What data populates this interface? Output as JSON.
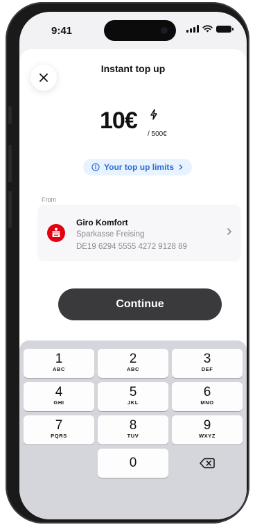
{
  "status_bar": {
    "time": "9:41",
    "signal_icon": "cellular-signal-icon",
    "wifi_icon": "wifi-icon",
    "battery_icon": "battery-icon"
  },
  "header": {
    "title": "Instant top up",
    "close_icon": "close-icon"
  },
  "amount": {
    "value": "10€",
    "limit": "/ 500€",
    "icon": "lightning-bolt-icon"
  },
  "limits_link": {
    "label": "Your top up limits",
    "info_icon": "info-icon",
    "chevron_icon": "chevron-right-icon"
  },
  "source": {
    "label": "From",
    "account_name": "Giro Komfort",
    "bank_name": "Sparkasse Freising",
    "iban": "DE19 6294 5555 4272 9128 89",
    "bank_logo_icon": "sparkasse-logo-icon",
    "chevron_icon": "chevron-right-icon"
  },
  "continue_button": {
    "label": "Continue"
  },
  "keypad": {
    "keys": [
      {
        "num": "1",
        "letters": "ABC"
      },
      {
        "num": "2",
        "letters": "ABC"
      },
      {
        "num": "3",
        "letters": "DEF"
      },
      {
        "num": "4",
        "letters": "GHI"
      },
      {
        "num": "5",
        "letters": "JKL"
      },
      {
        "num": "6",
        "letters": "MNO"
      },
      {
        "num": "7",
        "letters": "PQRS"
      },
      {
        "num": "8",
        "letters": "TUV"
      },
      {
        "num": "9",
        "letters": "WXYZ"
      },
      {
        "num": "0",
        "letters": ""
      }
    ],
    "backspace_icon": "backspace-icon"
  },
  "colors": {
    "accent_blue": "#2d6fd6",
    "pill_bg": "#e9f2ff",
    "button_dark": "#3a3a3c",
    "bank_red": "#e3000f"
  }
}
